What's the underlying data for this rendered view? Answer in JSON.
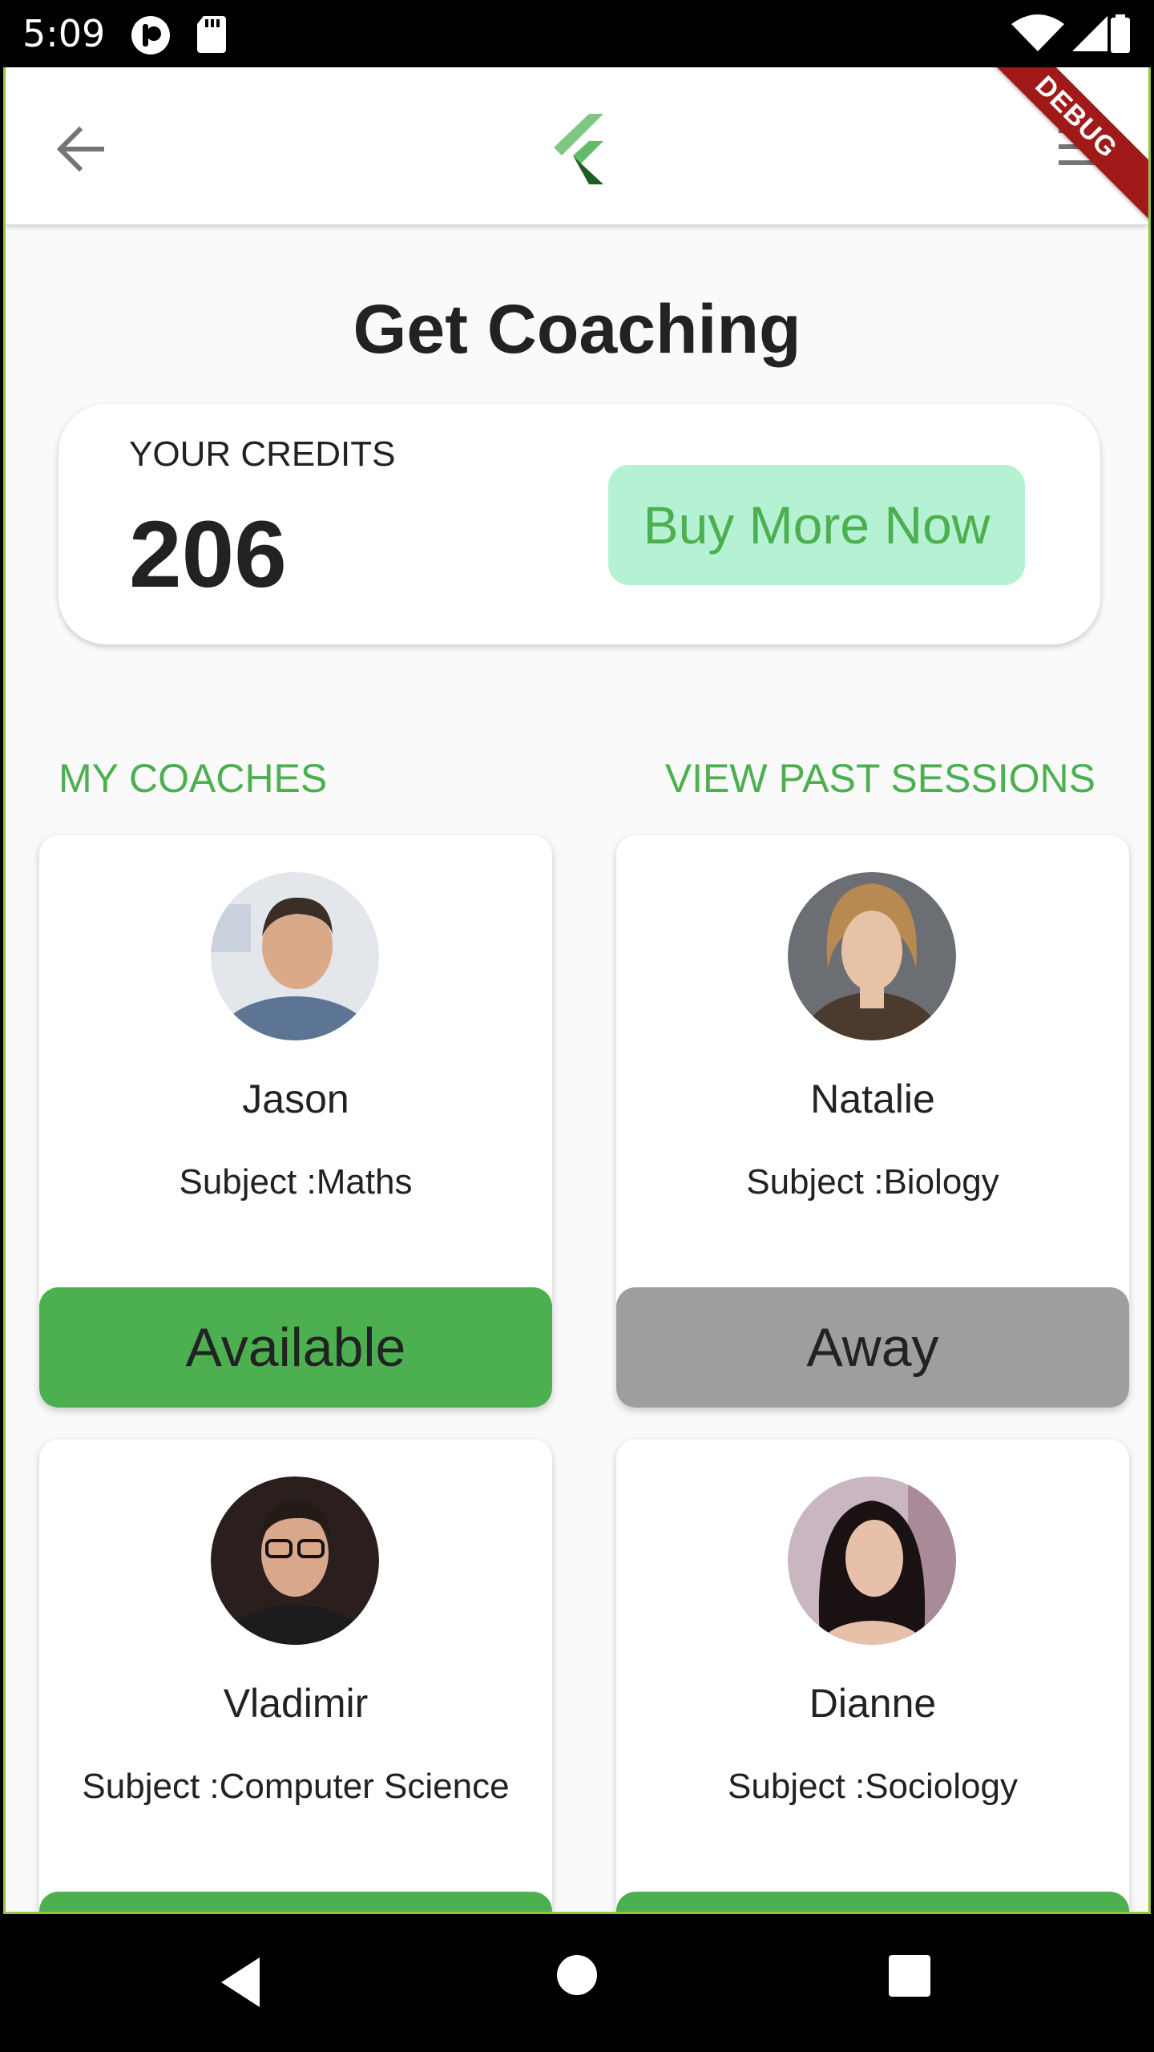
{
  "status_bar": {
    "time": "5:09"
  },
  "debug_banner": "DEBUG",
  "page_title": "Get Coaching",
  "credits": {
    "label": "YOUR CREDITS",
    "value": "206",
    "buy_label": "Buy More Now"
  },
  "links": {
    "my_coaches": "MY COACHES",
    "past_sessions": "VIEW PAST SESSIONS"
  },
  "coaches": [
    {
      "name": "Jason",
      "subject": "Subject :Maths",
      "status": "Available",
      "status_color": "#4caf50"
    },
    {
      "name": "Natalie",
      "subject": "Subject :Biology",
      "status": "Away",
      "status_color": "#9e9e9e"
    },
    {
      "name": "Vladimir",
      "subject": "Subject :Computer Science",
      "status": "",
      "status_color": "#4caf50"
    },
    {
      "name": "Dianne",
      "subject": "Subject :Sociology",
      "status": "",
      "status_color": "#4caf50"
    }
  ],
  "colors": {
    "accent": "#4caf50",
    "buy_button_bg": "#b5f2d3",
    "away": "#9e9e9e",
    "debug_ribbon": "#a01a1a"
  },
  "icons": {
    "back": "arrow-left-icon",
    "logo": "flutter-logo",
    "menu": "hamburger-menu-icon"
  }
}
